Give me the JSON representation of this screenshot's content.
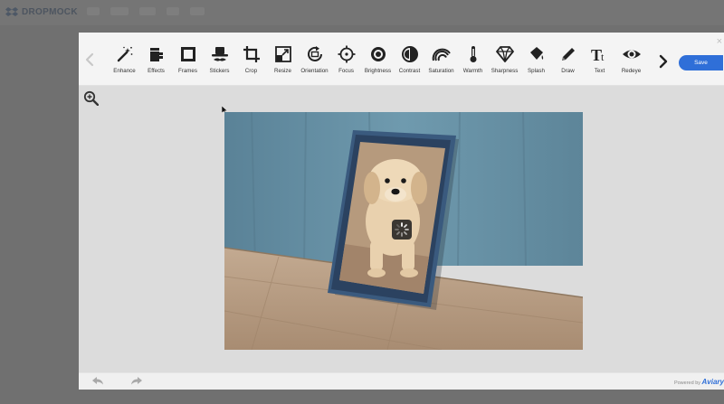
{
  "app": {
    "brand": "DROPMOCK"
  },
  "editor": {
    "close_label": "×",
    "tools": [
      {
        "label": "Enhance",
        "icon": "magic-wand-icon"
      },
      {
        "label": "Effects",
        "icon": "effects-cup-icon"
      },
      {
        "label": "Frames",
        "icon": "frame-icon"
      },
      {
        "label": "Stickers",
        "icon": "hat-mustache-icon"
      },
      {
        "label": "Crop",
        "icon": "crop-icon"
      },
      {
        "label": "Resize",
        "icon": "resize-icon"
      },
      {
        "label": "Orientation",
        "icon": "rotate-icon"
      },
      {
        "label": "Focus",
        "icon": "focus-crosshair-icon"
      },
      {
        "label": "Brightness",
        "icon": "sun-icon"
      },
      {
        "label": "Contrast",
        "icon": "contrast-icon"
      },
      {
        "label": "Saturation",
        "icon": "saturation-icon"
      },
      {
        "label": "Warmth",
        "icon": "thermometer-icon"
      },
      {
        "label": "Sharpness",
        "icon": "diamond-icon"
      },
      {
        "label": "Splash",
        "icon": "paint-bucket-icon"
      },
      {
        "label": "Draw",
        "icon": "pencil-icon"
      },
      {
        "label": "Text",
        "icon": "text-icon"
      },
      {
        "label": "Redeye",
        "icon": "eye-icon"
      }
    ],
    "save_label": "Save",
    "powered_by": "Powered by",
    "powered_brand": "Aviary",
    "colors": {
      "accent": "#2f6fd8",
      "toolbar": "#f4f4f4",
      "canvas": "#dcdcdc",
      "overlay": "#707070"
    }
  }
}
